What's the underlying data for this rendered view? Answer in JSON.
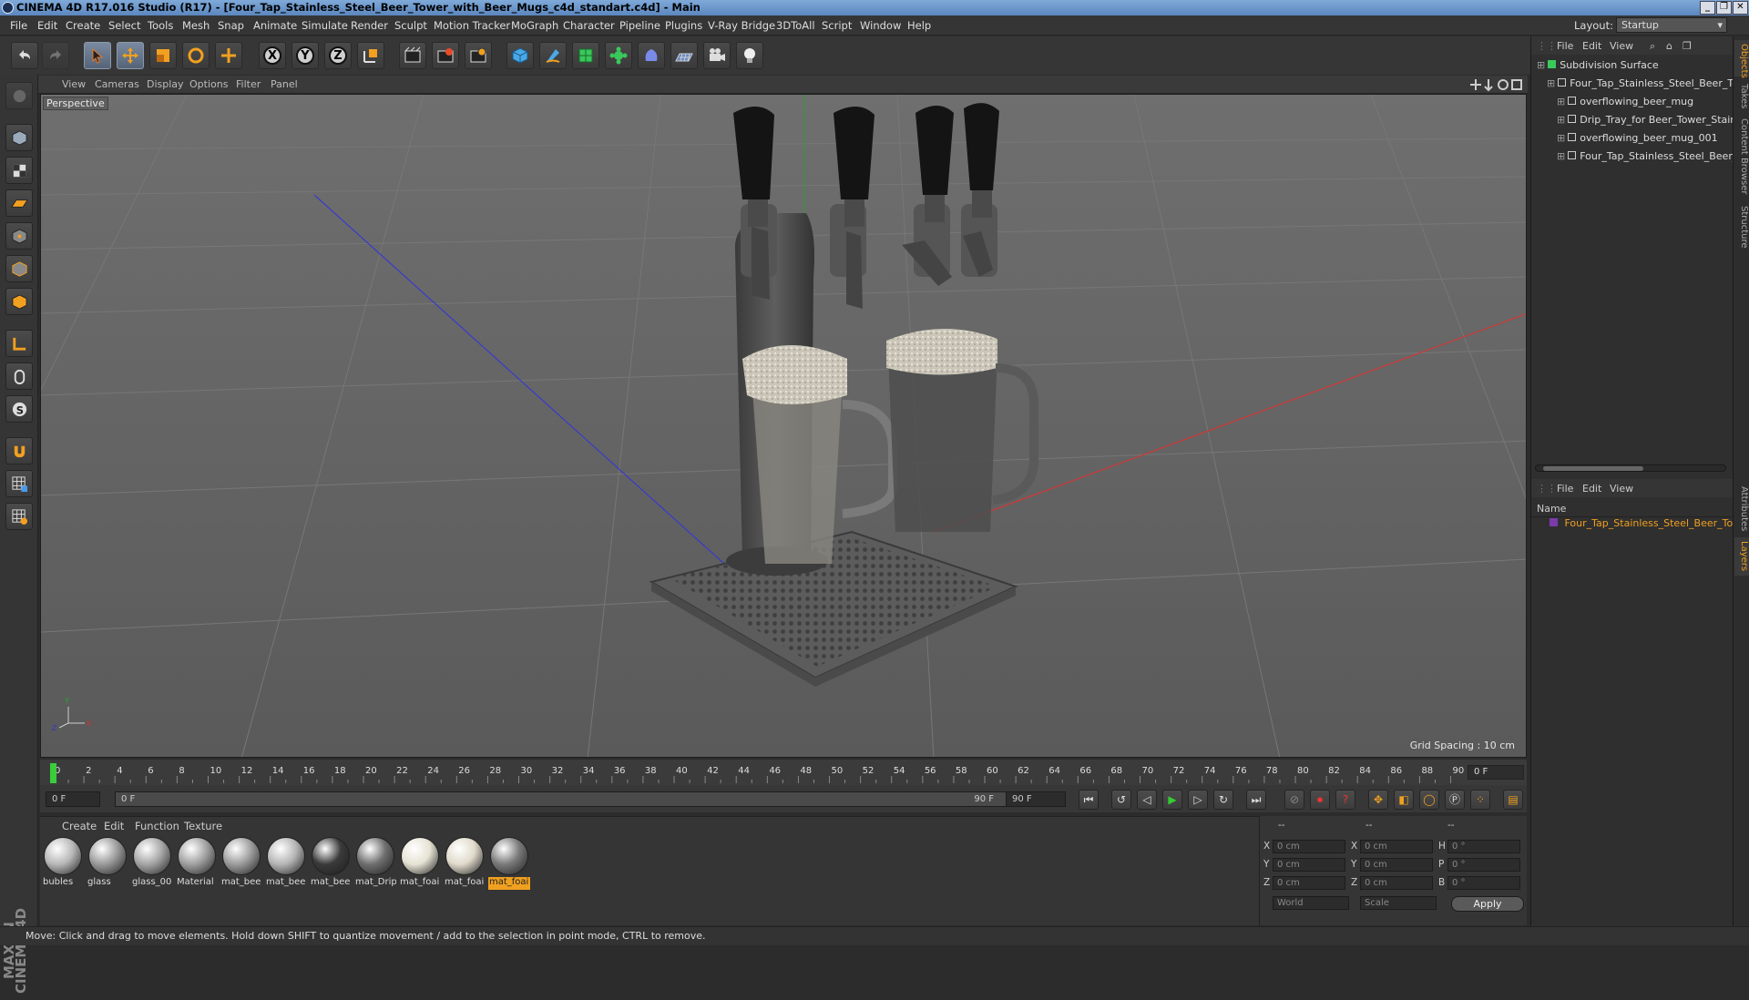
{
  "window": {
    "title": "CINEMA 4D R17.016 Studio (R17) - [Four_Tap_Stainless_Steel_Beer_Tower_with_Beer_Mugs_c4d_standart.c4d] - Main",
    "buttons": [
      "_",
      "❐",
      "✕"
    ]
  },
  "menubar": {
    "items": [
      "File",
      "Edit",
      "Create",
      "Select",
      "Tools",
      "Mesh",
      "Snap",
      "Animate",
      "Simulate",
      "Render",
      "Sculpt",
      "Motion Tracker",
      "MoGraph",
      "Character",
      "Pipeline",
      "Plugins",
      "V-Ray Bridge",
      "3DToAll",
      "Script",
      "Window",
      "Help"
    ],
    "layout_label": "Layout:",
    "layout_value": "Startup"
  },
  "toolbar": {
    "icons": [
      "undo-icon",
      "redo-icon",
      "select-cursor-icon",
      "move-icon",
      "scale-icon",
      "rotate-icon",
      "live-select-icon",
      "x-axis-icon",
      "y-axis-icon",
      "z-axis-icon",
      "coordinate-system-icon",
      "render-view-icon",
      "render-picture-viewer-icon",
      "render-settings-icon",
      "cube-icon",
      "pen-icon",
      "subdivision-icon",
      "cloner-icon",
      "deformer-icon",
      "floor-icon",
      "camera-icon",
      "light-icon"
    ],
    "axis_x": "X",
    "axis_y": "Y",
    "axis_z": "Z"
  },
  "viewport": {
    "menu": [
      "View",
      "Cameras",
      "Display",
      "Options",
      "Filter",
      "Panel"
    ],
    "label": "Perspective",
    "grid_spacing": "Grid Spacing : 10 cm",
    "axis_labels": {
      "y": "Y",
      "x": "X",
      "z": "Z"
    }
  },
  "timeline": {
    "ticks": [
      "0",
      "2",
      "4",
      "6",
      "8",
      "10",
      "12",
      "14",
      "16",
      "18",
      "20",
      "22",
      "24",
      "26",
      "28",
      "30",
      "32",
      "34",
      "36",
      "38",
      "40",
      "42",
      "44",
      "46",
      "48",
      "50",
      "52",
      "54",
      "56",
      "58",
      "60",
      "62",
      "64",
      "66",
      "68",
      "70",
      "72",
      "74",
      "76",
      "78",
      "80",
      "82",
      "84",
      "86",
      "88",
      "90"
    ],
    "current_frame": "0 F",
    "start_field": "0 F",
    "range_start": "0 F",
    "range_end": "90 F",
    "end_field": "90 F"
  },
  "materials": {
    "menu": [
      "Create",
      "Edit",
      "Function",
      "Texture"
    ],
    "items": [
      {
        "label": "bubles",
        "color": "#b8b8b8"
      },
      {
        "label": "glass",
        "color": "#9a9a9a"
      },
      {
        "label": "glass_00",
        "color": "#a5a5a5"
      },
      {
        "label": "Material",
        "color": "#a0a0a0"
      },
      {
        "label": "mat_bee",
        "color": "#9c9c9c"
      },
      {
        "label": "mat_bee",
        "color": "#b5b5b5"
      },
      {
        "label": "mat_bee",
        "color": "#3a3a3a"
      },
      {
        "label": "mat_Drip",
        "color": "#6f6f6f"
      },
      {
        "label": "mat_foai",
        "color": "#e6e2d4"
      },
      {
        "label": "mat_foai",
        "color": "#e0dacb"
      },
      {
        "label": "mat_foai",
        "color": "#7a7a7a"
      }
    ]
  },
  "coordinates": {
    "header": [
      "--",
      "--",
      "--"
    ],
    "rows": [
      {
        "a": "X",
        "av": "0 cm",
        "b": "X",
        "bv": "0 cm",
        "c": "H",
        "cv": "0 °"
      },
      {
        "a": "Y",
        "av": "0 cm",
        "b": "Y",
        "bv": "0 cm",
        "c": "P",
        "cv": "0 °"
      },
      {
        "a": "Z",
        "av": "0 cm",
        "b": "Z",
        "bv": "0 cm",
        "c": "B",
        "cv": "0 °"
      }
    ],
    "mode_world": "World",
    "mode_scale": "Scale",
    "apply": "Apply"
  },
  "objects": {
    "menu": [
      "File",
      "Edit",
      "View"
    ],
    "tree": [
      {
        "label": "Subdivision Surface",
        "indent": 0
      },
      {
        "label": "Four_Tap_Stainless_Steel_Beer_Tc",
        "indent": 1
      },
      {
        "label": "overflowing_beer_mug",
        "indent": 2
      },
      {
        "label": "Drip_Tray_for Beer_Tower_Stain",
        "indent": 2
      },
      {
        "label": "overflowing_beer_mug_001",
        "indent": 2
      },
      {
        "label": "Four_Tap_Stainless_Steel_Beer_",
        "indent": 2
      }
    ]
  },
  "layers": {
    "menu": [
      "File",
      "Edit",
      "View"
    ],
    "name_header": "Name",
    "row": "Four_Tap_Stainless_Steel_Beer_Tov"
  },
  "sidetabs": [
    "Objects",
    "Takes",
    "Content Browser",
    "Structure",
    "Attributes",
    "Layers"
  ],
  "branding": "MAXON CINEMA 4D",
  "status": "Move: Click and drag to move elements. Hold down SHIFT to quantize movement / add to the selection in point mode, CTRL to remove."
}
